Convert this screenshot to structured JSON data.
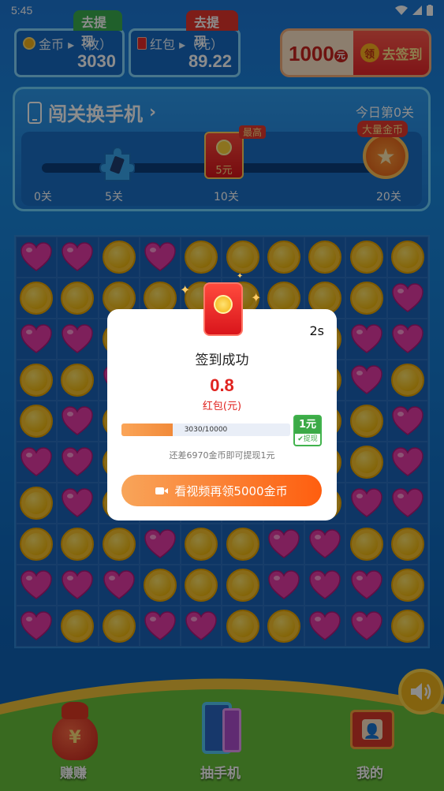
{
  "status_bar": {
    "time": "5:45"
  },
  "currency": {
    "coins": {
      "label": "金币 ▸（枚）",
      "value": "3030",
      "tag": "去提现"
    },
    "red_packet": {
      "label": "红包 ▸（元）",
      "value": "89.22",
      "tag": "去提现"
    }
  },
  "sign_in": {
    "amount": "1000",
    "unit": "元",
    "ling": "领",
    "label": "去签到"
  },
  "level_card": {
    "title": "闯关换手机",
    "today": "今日第0关",
    "milestones": [
      "0关",
      "5关",
      "10关",
      "20关"
    ],
    "best_tag": "最高",
    "packet_value": "5元",
    "big_coin_tag": "大量金币"
  },
  "board": [
    [
      "heart",
      "heart",
      "coin",
      "heart",
      "coin",
      "coin",
      "coin",
      "coin",
      "coin",
      "coin"
    ],
    [
      "coin",
      "coin",
      "coin",
      "coin",
      "coin",
      "coin",
      "coin",
      "coin",
      "coin",
      "heart"
    ],
    [
      "heart",
      "heart",
      "coin",
      "coin",
      "coin",
      "coin",
      "coin",
      "coin",
      "heart",
      "heart"
    ],
    [
      "coin",
      "coin",
      "heart",
      "coin",
      "coin",
      "coin",
      "coin",
      "coin",
      "heart",
      "coin"
    ],
    [
      "coin",
      "heart",
      "coin",
      "coin",
      "coin",
      "coin",
      "coin",
      "coin",
      "coin",
      "heart"
    ],
    [
      "heart",
      "heart",
      "coin",
      "coin",
      "coin",
      "coin",
      "coin",
      "coin",
      "coin",
      "heart"
    ],
    [
      "coin",
      "heart",
      "coin",
      "coin",
      "coin",
      "coin",
      "coin",
      "coin",
      "heart",
      "heart"
    ],
    [
      "coin",
      "coin",
      "coin",
      "heart",
      "coin",
      "coin",
      "heart",
      "heart",
      "coin",
      "coin"
    ],
    [
      "heart",
      "heart",
      "heart",
      "coin",
      "coin",
      "coin",
      "heart",
      "heart",
      "heart",
      "coin"
    ],
    [
      "heart",
      "coin",
      "coin",
      "heart",
      "heart",
      "coin",
      "coin",
      "heart",
      "heart",
      "coin"
    ]
  ],
  "dialog": {
    "timer": "2s",
    "title": "签到成功",
    "amount": "0.8",
    "unit": "红包(元)",
    "progress_text": "3030/10000",
    "progress_fraction": 0.303,
    "badge_value": "1元",
    "badge_label": "提现",
    "hint": "还差6970金币即可提现1元",
    "video_button": "看视频再领5000金币"
  },
  "nav": {
    "earn": "赚赚",
    "phone": "抽手机",
    "mine": "我的",
    "earn_glyph": "¥"
  }
}
